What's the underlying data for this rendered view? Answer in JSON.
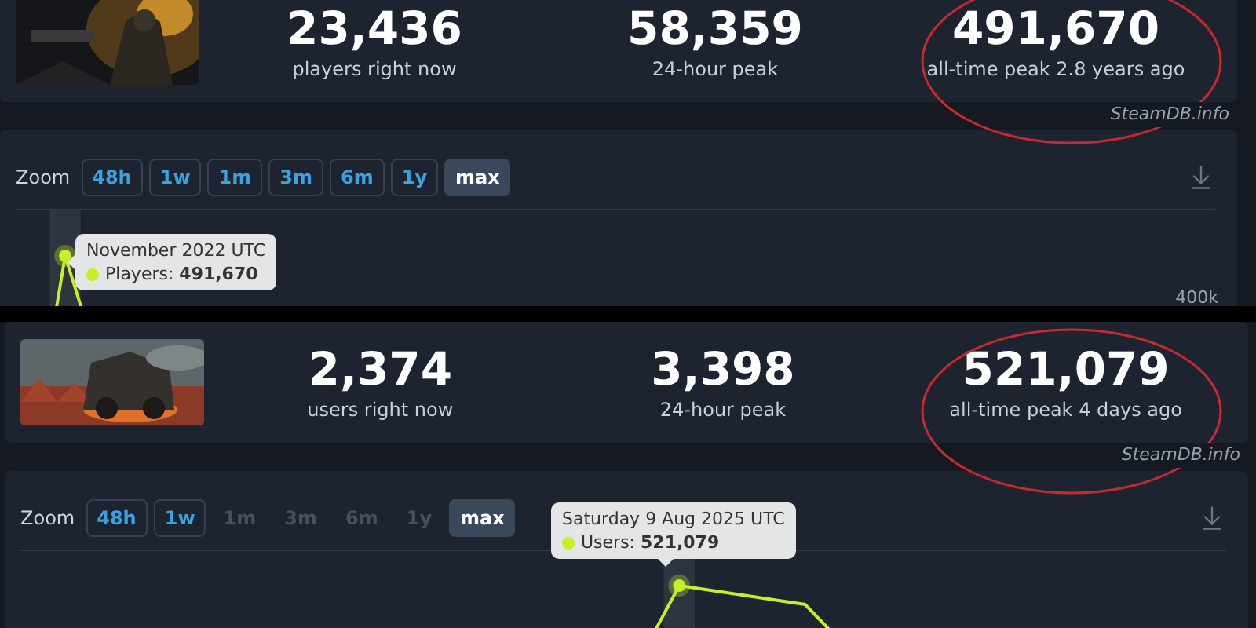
{
  "sections": [
    {
      "stats": [
        {
          "value": "23,436",
          "label": "players right now"
        },
        {
          "value": "58,359",
          "label": "24-hour peak"
        },
        {
          "value": "491,670",
          "label": "all-time peak 2.8 years ago"
        }
      ],
      "watermark": "SteamDB.info",
      "zoom": {
        "label": "Zoom",
        "buttons": [
          {
            "label": "48h",
            "enabled": true,
            "selected": false
          },
          {
            "label": "1w",
            "enabled": true,
            "selected": false
          },
          {
            "label": "1m",
            "enabled": true,
            "selected": false
          },
          {
            "label": "3m",
            "enabled": true,
            "selected": false
          },
          {
            "label": "6m",
            "enabled": true,
            "selected": false
          },
          {
            "label": "1y",
            "enabled": true,
            "selected": false
          },
          {
            "label": "max",
            "enabled": true,
            "selected": true
          }
        ]
      },
      "tooltip": {
        "date": "November 2022 UTC",
        "label": "Players:",
        "value": "491,670"
      },
      "y_label": "400k"
    },
    {
      "stats": [
        {
          "value": "2,374",
          "label": "users right now"
        },
        {
          "value": "3,398",
          "label": "24-hour peak"
        },
        {
          "value": "521,079",
          "label": "all-time peak 4 days ago"
        }
      ],
      "watermark": "SteamDB.info",
      "zoom": {
        "label": "Zoom",
        "buttons": [
          {
            "label": "48h",
            "enabled": true,
            "selected": false
          },
          {
            "label": "1w",
            "enabled": true,
            "selected": false
          },
          {
            "label": "1m",
            "enabled": false,
            "selected": false
          },
          {
            "label": "3m",
            "enabled": false,
            "selected": false
          },
          {
            "label": "6m",
            "enabled": false,
            "selected": false
          },
          {
            "label": "1y",
            "enabled": false,
            "selected": false
          },
          {
            "label": "max",
            "enabled": true,
            "selected": true
          }
        ]
      },
      "tooltip": {
        "date": "Saturday 9 Aug 2025 UTC",
        "label": "Users:",
        "value": "521,079"
      }
    }
  ]
}
